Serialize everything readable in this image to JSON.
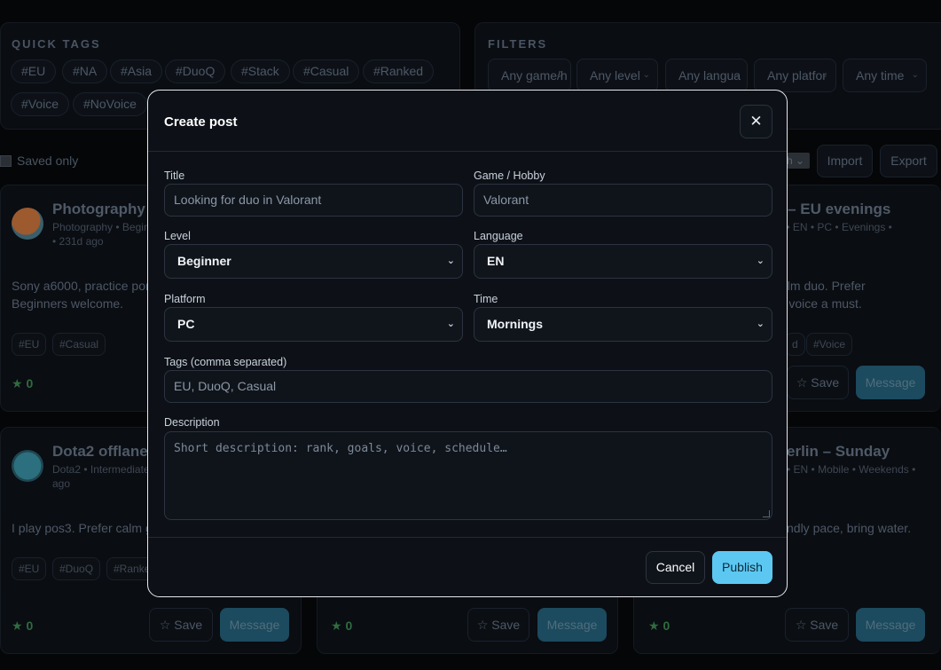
{
  "quick_tags": {
    "title": "QUICK TAGS",
    "tags": [
      "#EU",
      "#NA",
      "#Asia",
      "#DuoQ",
      "#Stack",
      "#Casual",
      "#Ranked",
      "#Voice",
      "#NoVoice"
    ]
  },
  "filters": {
    "title": "FILTERS",
    "selects": [
      "Any game/h",
      "Any level",
      "Any langua",
      "Any platfor",
      "Any time"
    ]
  },
  "toolbar": {
    "saved_only_label": "Saved only",
    "sort_value": "h",
    "import_label": "Import",
    "export_label": "Export"
  },
  "cards": [
    {
      "title": "Photography w",
      "meta_line1": "Photography • Begin",
      "meta_line2": "• 231d ago",
      "desc_line1": "Sony a6000, practice por",
      "desc_line2": "Beginners welcome.",
      "tags": [
        "#EU",
        "#Casual"
      ],
      "stars": "★ 0",
      "avatar_color": "#8a4a25"
    },
    {
      "title": "o – EU evenings",
      "meta_line1": "te • EN • PC • Evenings •",
      "desc_line1": "calm duo. Prefer",
      "desc_line2": "rd voice a must.",
      "tags": [
        "d",
        "#Voice"
      ],
      "save_label": "☆ Save",
      "message_label": "Message"
    },
    {
      "title": "Dota2 offlane",
      "meta_line1": "Dota2 • Intermediate",
      "meta_line2": "ago",
      "desc_line1": "I play pos3. Prefer calm g",
      "tags": [
        "#EU",
        "#DuoQ",
        "#Ranke"
      ],
      "stars": "★ 0",
      "save_label": "☆ Save",
      "message_label": "Message",
      "avatar_color": "#2f6c7a"
    },
    {
      "stars": "★ 0",
      "save_label": "☆ Save",
      "message_label": "Message"
    },
    {
      "title": "erlin – Sunday",
      "meta_line1": "• EN • Mobile • Weekends •",
      "desc_line1": "ndly pace, bring water.",
      "stars": "★ 0",
      "save_label": "☆ Save",
      "message_label": "Message"
    }
  ],
  "modal": {
    "title": "Create post",
    "close_symbol": "✕",
    "fields": {
      "title": {
        "label": "Title",
        "placeholder": "Looking for duo in Valorant"
      },
      "game": {
        "label": "Game / Hobby",
        "placeholder": "Valorant"
      },
      "level": {
        "label": "Level",
        "value": "Beginner"
      },
      "language": {
        "label": "Language",
        "value": "EN"
      },
      "platform": {
        "label": "Platform",
        "value": "PC"
      },
      "time": {
        "label": "Time",
        "value": "Mornings"
      },
      "tags": {
        "label": "Tags (comma separated)",
        "placeholder": "EU, DuoQ, Casual"
      },
      "description": {
        "label": "Description",
        "placeholder": "Short description: rank, goals, voice, schedule…"
      }
    },
    "cancel_label": "Cancel",
    "publish_label": "Publish"
  },
  "colors": {
    "accent": "#5cc8f2",
    "star_green": "#2f6b3f",
    "modal_bg": "#0d1117"
  }
}
